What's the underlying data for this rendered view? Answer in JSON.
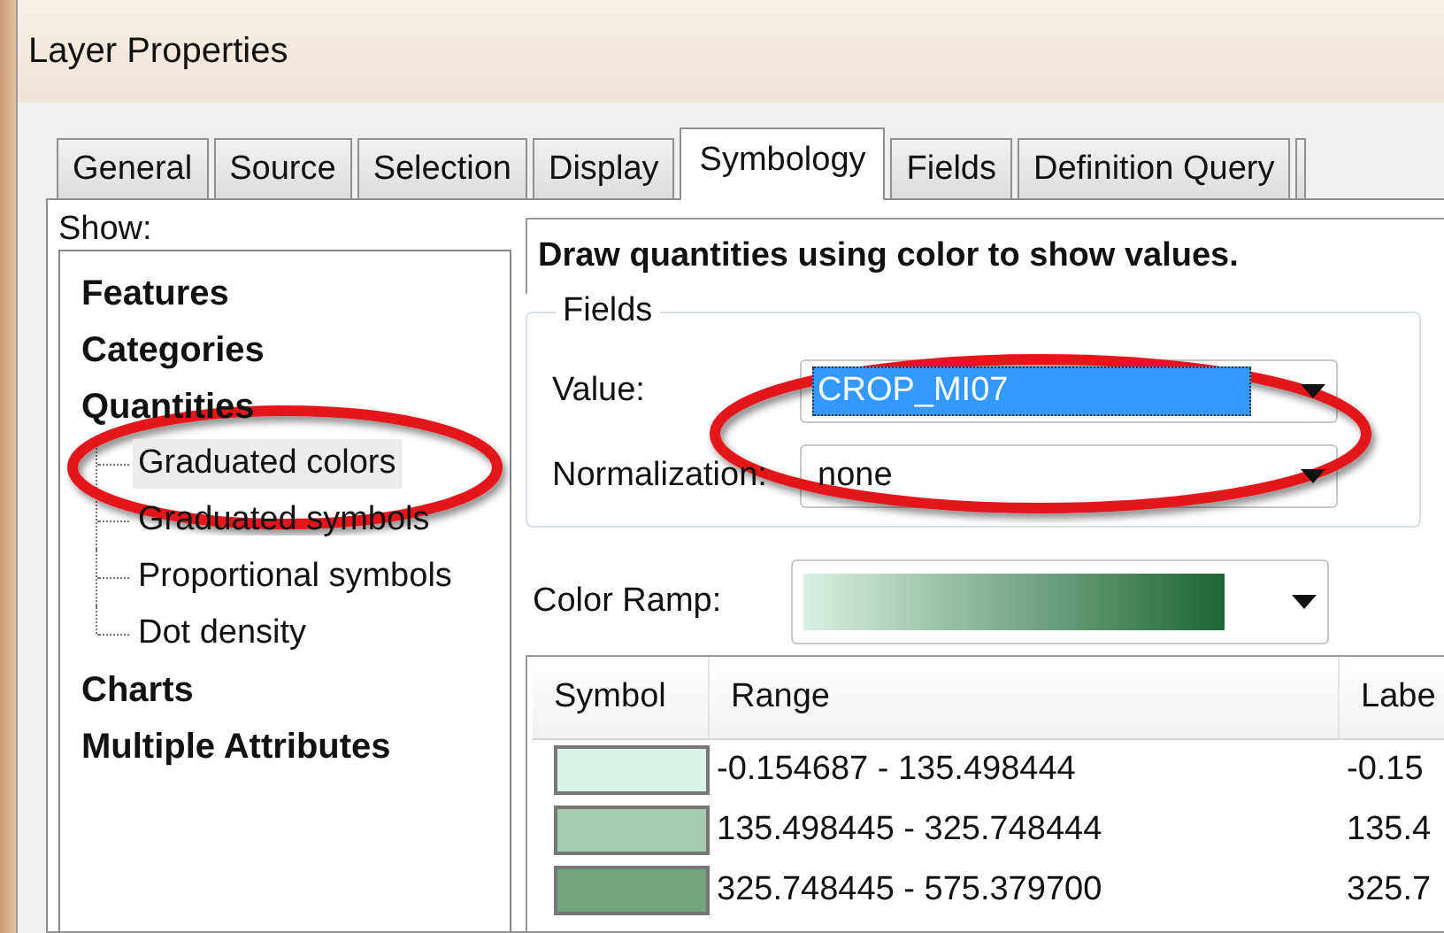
{
  "window": {
    "title": "Layer Properties"
  },
  "tabs": [
    {
      "label": "General",
      "selected": false
    },
    {
      "label": "Source",
      "selected": false
    },
    {
      "label": "Selection",
      "selected": false
    },
    {
      "label": "Display",
      "selected": false
    },
    {
      "label": "Symbology",
      "selected": true
    },
    {
      "label": "Fields",
      "selected": false
    },
    {
      "label": "Definition Query",
      "selected": false
    }
  ],
  "show": {
    "label": "Show:",
    "items": [
      {
        "label": "Features",
        "selected": false
      },
      {
        "label": "Categories",
        "selected": false
      },
      {
        "label": "Quantities",
        "selected": false,
        "children": [
          {
            "label": "Graduated colors",
            "selected": true
          },
          {
            "label": "Graduated symbols",
            "selected": false
          },
          {
            "label": "Proportional symbols",
            "selected": false
          },
          {
            "label": "Dot density",
            "selected": false
          }
        ]
      },
      {
        "label": "Charts",
        "selected": false
      },
      {
        "label": "Multiple Attributes",
        "selected": false
      }
    ]
  },
  "description": "Draw quantities using color to show values.",
  "fields": {
    "title": "Fields",
    "value": {
      "label": "Value:",
      "value": "CROP_MI07",
      "focused": true
    },
    "normalization": {
      "label": "Normalization:",
      "value": "none",
      "focused": false
    }
  },
  "color_ramp": {
    "label": "Color Ramp:",
    "stops": [
      {
        "color": "#d9f0e3"
      },
      {
        "color": "#1f6533"
      }
    ]
  },
  "classes": {
    "columns": [
      "Symbol",
      "Range",
      "Labe"
    ],
    "rows": [
      {
        "color": "#dbf2e7",
        "range": "-0.154687 - 135.498444",
        "label": "-0.15"
      },
      {
        "color": "#a3ccae",
        "range": "135.498445 - 325.748444",
        "label": "135.4"
      },
      {
        "color": "#72a57e",
        "range": "325.748445 - 575.379700",
        "label": "325.7"
      }
    ]
  }
}
